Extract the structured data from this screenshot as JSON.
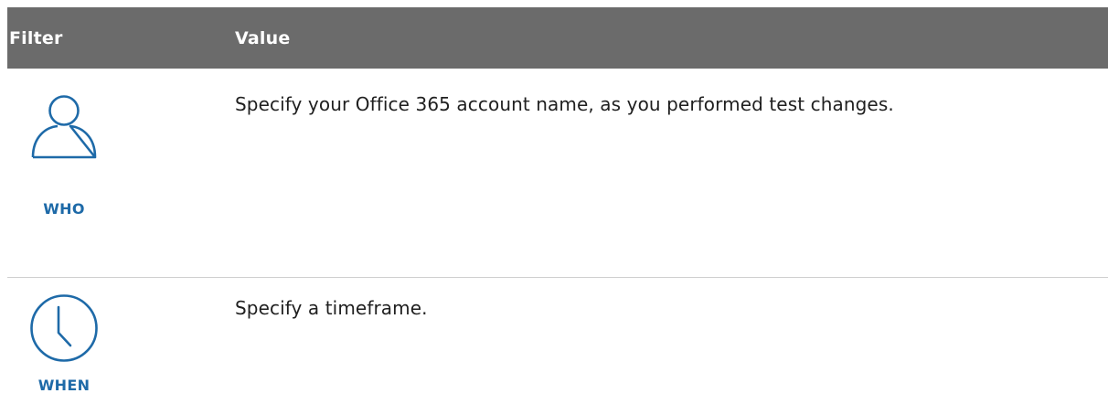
{
  "table": {
    "headers": {
      "filter": "Filter",
      "value": "Value"
    },
    "rows": [
      {
        "icon": "user-icon",
        "caption": "WHO",
        "value": "Specify your Office 365 account name, as you performed test changes."
      },
      {
        "icon": "clock-icon",
        "caption": "WHEN",
        "value": "Specify a timeframe."
      }
    ]
  },
  "colors": {
    "header_background": "#6b6b6b",
    "header_text": "#ffffff",
    "icon_blue": "#1e6aa8",
    "divider": "#cfcfcf"
  }
}
